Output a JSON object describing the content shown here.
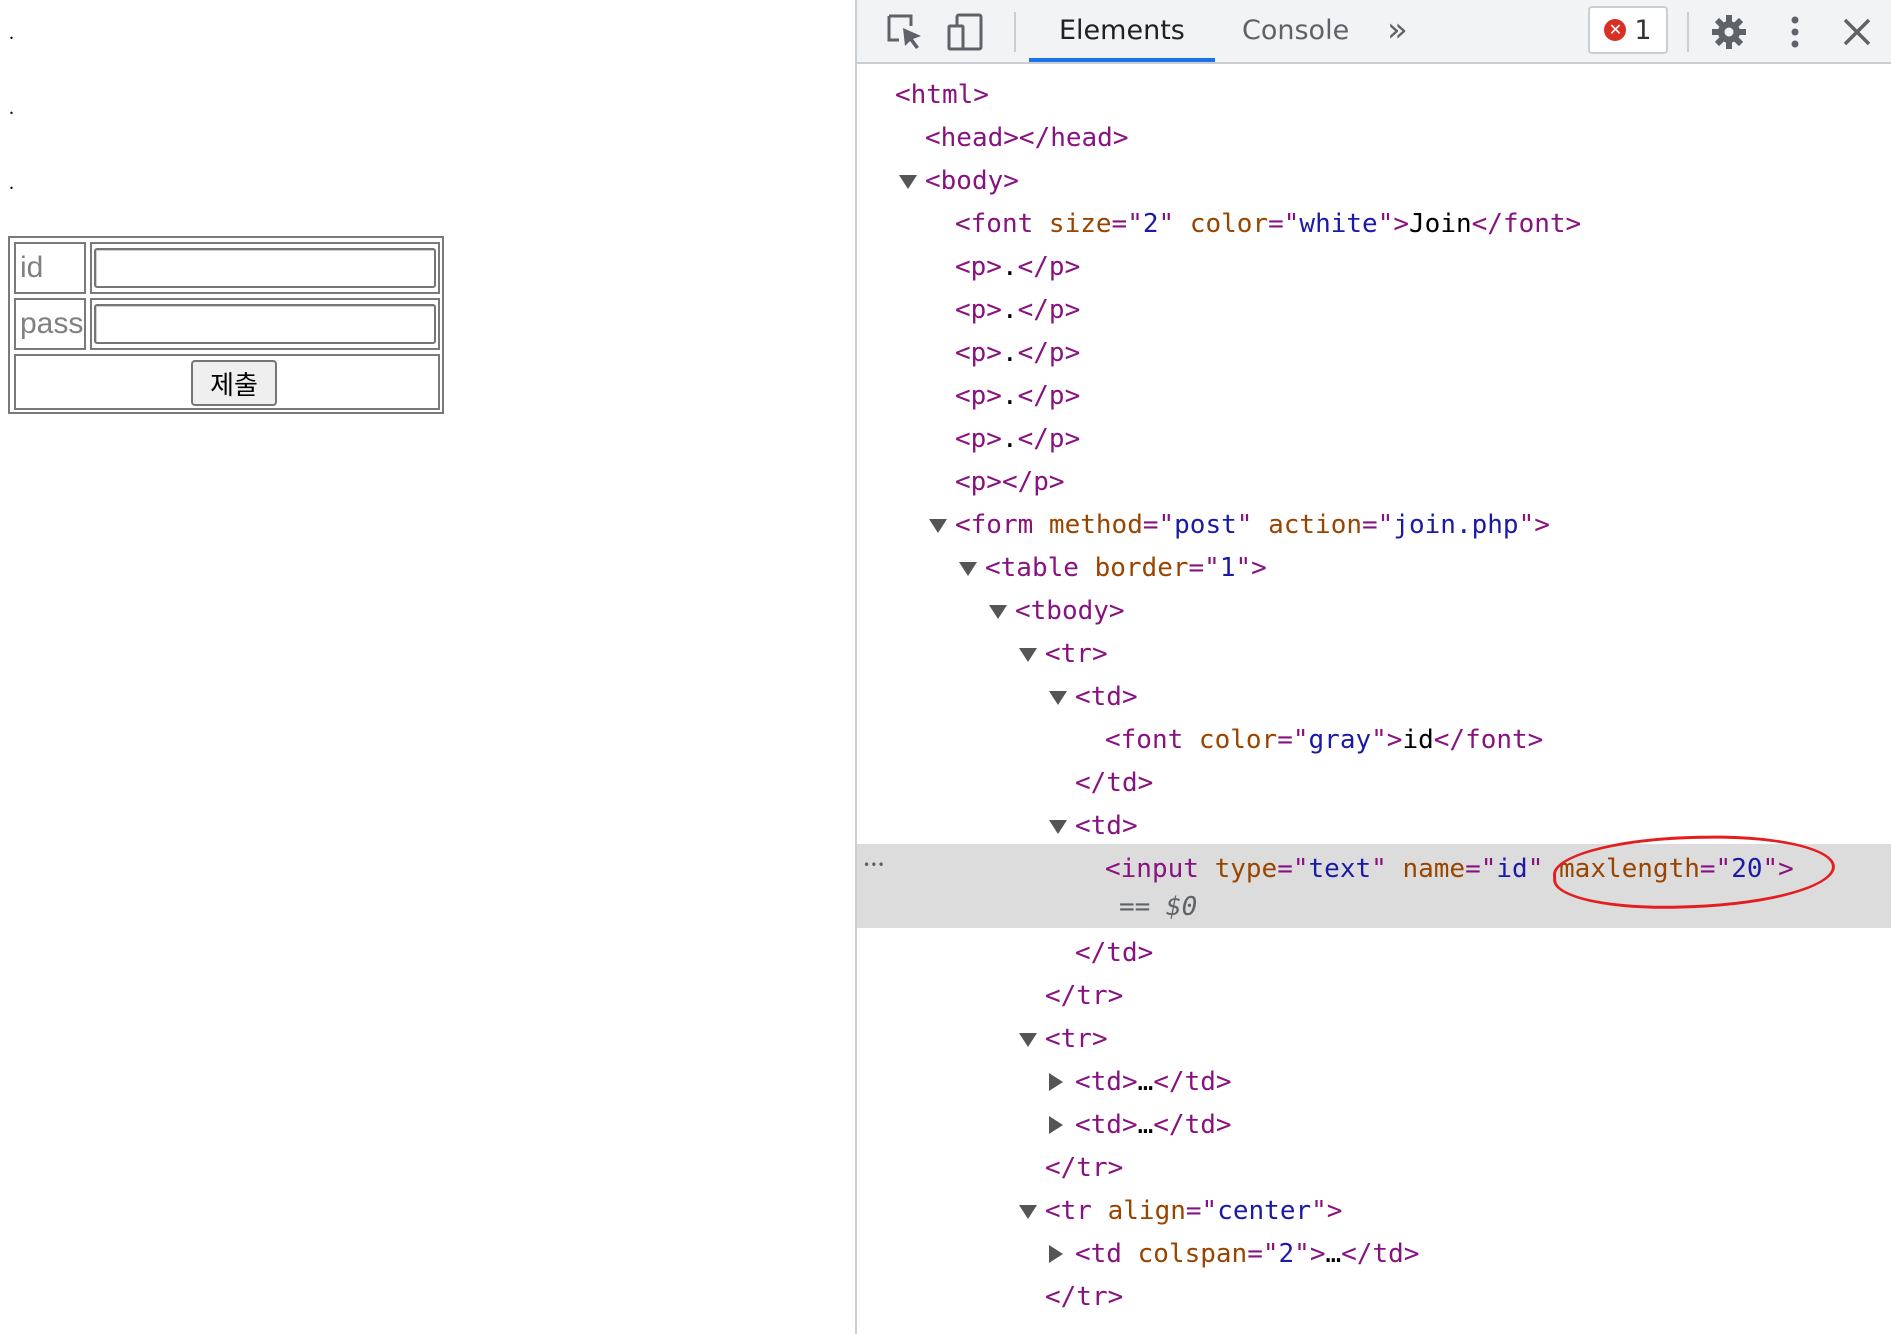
{
  "page": {
    "dots": [
      ".",
      ".",
      "."
    ],
    "form": {
      "id_label": "id",
      "pass_label": "pass",
      "submit_label": "제출"
    }
  },
  "devtools": {
    "tabs": [
      {
        "label": "Elements",
        "active": true
      },
      {
        "label": "Console",
        "active": false
      }
    ],
    "more_tabs": "»",
    "error_count": "1",
    "icons": [
      "inspect-element-icon",
      "device-toolbar-icon",
      "settings-icon",
      "more-options-icon",
      "close-icon"
    ],
    "dom_rows": [
      {
        "parts": [
          [
            "tag",
            "<html>"
          ]
        ]
      },
      {
        "parts": [
          [
            "tag",
            "<head></head>"
          ]
        ]
      },
      {
        "parts": [
          [
            "tag",
            "<body>"
          ]
        ]
      },
      {
        "parts": [
          [
            "tag",
            "<font "
          ],
          [
            "attr",
            "size"
          ],
          [
            "tag",
            "=\""
          ],
          [
            "val",
            "2"
          ],
          [
            "tag",
            "\" "
          ],
          [
            "attr",
            "color"
          ],
          [
            "tag",
            "=\""
          ],
          [
            "val",
            "white"
          ],
          [
            "tag",
            "\">"
          ],
          [
            "txt",
            "Join"
          ],
          [
            "tag",
            "</font>"
          ]
        ]
      },
      {
        "parts": [
          [
            "tag",
            "<p>"
          ],
          [
            "txt",
            "."
          ],
          [
            "tag",
            "</p>"
          ]
        ]
      },
      {
        "parts": [
          [
            "tag",
            "<p>"
          ],
          [
            "txt",
            "."
          ],
          [
            "tag",
            "</p>"
          ]
        ]
      },
      {
        "parts": [
          [
            "tag",
            "<p>"
          ],
          [
            "txt",
            "."
          ],
          [
            "tag",
            "</p>"
          ]
        ]
      },
      {
        "parts": [
          [
            "tag",
            "<p>"
          ],
          [
            "txt",
            "."
          ],
          [
            "tag",
            "</p>"
          ]
        ]
      },
      {
        "parts": [
          [
            "tag",
            "<p>"
          ],
          [
            "txt",
            "."
          ],
          [
            "tag",
            "</p>"
          ]
        ]
      },
      {
        "parts": [
          [
            "tag",
            "<p></p>"
          ]
        ]
      },
      {
        "parts": [
          [
            "tag",
            "<form "
          ],
          [
            "attr",
            "method"
          ],
          [
            "tag",
            "=\""
          ],
          [
            "val",
            "post"
          ],
          [
            "tag",
            "\" "
          ],
          [
            "attr",
            "action"
          ],
          [
            "tag",
            "=\""
          ],
          [
            "val",
            "join.php"
          ],
          [
            "tag",
            "\">"
          ]
        ]
      },
      {
        "parts": [
          [
            "tag",
            "<table "
          ],
          [
            "attr",
            "border"
          ],
          [
            "tag",
            "=\""
          ],
          [
            "val",
            "1"
          ],
          [
            "tag",
            "\">"
          ]
        ]
      },
      {
        "parts": [
          [
            "tag",
            "<tbody>"
          ]
        ]
      },
      {
        "parts": [
          [
            "tag",
            "<tr>"
          ]
        ]
      },
      {
        "parts": [
          [
            "tag",
            "<td>"
          ]
        ]
      },
      {
        "parts": [
          [
            "tag",
            "<font "
          ],
          [
            "attr",
            "color"
          ],
          [
            "tag",
            "=\""
          ],
          [
            "val",
            "gray"
          ],
          [
            "tag",
            "\">"
          ],
          [
            "txt",
            "id"
          ],
          [
            "tag",
            "</font>"
          ]
        ]
      },
      {
        "parts": [
          [
            "tag",
            "</td>"
          ]
        ]
      },
      {
        "parts": [
          [
            "tag",
            "<td>"
          ]
        ]
      },
      {
        "parts": [
          [
            "tag",
            "<input "
          ],
          [
            "attr",
            "type"
          ],
          [
            "tag",
            "=\""
          ],
          [
            "val",
            "text"
          ],
          [
            "tag",
            "\" "
          ],
          [
            "attr",
            "name"
          ],
          [
            "tag",
            "=\""
          ],
          [
            "val",
            "id"
          ],
          [
            "tag",
            "\" "
          ],
          [
            "attr",
            "maxlength"
          ],
          [
            "tag",
            "=\""
          ],
          [
            "val",
            "20"
          ],
          [
            "tag",
            "\">"
          ]
        ],
        "selected_suffix": "== $0"
      },
      {
        "parts": [
          [
            "tag",
            "</td>"
          ]
        ]
      },
      {
        "parts": [
          [
            "tag",
            "</tr>"
          ]
        ]
      },
      {
        "parts": [
          [
            "tag",
            "<tr>"
          ]
        ]
      },
      {
        "parts": [
          [
            "tag",
            "<td>"
          ],
          [
            "txt",
            "…"
          ],
          [
            "tag",
            "</td>"
          ]
        ]
      },
      {
        "parts": [
          [
            "tag",
            "<td>"
          ],
          [
            "txt",
            "…"
          ],
          [
            "tag",
            "</td>"
          ]
        ]
      },
      {
        "parts": [
          [
            "tag",
            "</tr>"
          ]
        ]
      },
      {
        "parts": [
          [
            "tag",
            "<tr "
          ],
          [
            "attr",
            "align"
          ],
          [
            "tag",
            "=\""
          ],
          [
            "val",
            "center"
          ],
          [
            "tag",
            "\">"
          ]
        ]
      },
      {
        "parts": [
          [
            "tag",
            "<td "
          ],
          [
            "attr",
            "colspan"
          ],
          [
            "tag",
            "=\""
          ],
          [
            "val",
            "2"
          ],
          [
            "tag",
            "\">"
          ],
          [
            "txt",
            "…"
          ],
          [
            "tag",
            "</td>"
          ]
        ]
      },
      {
        "parts": [
          [
            "tag",
            "</tr>"
          ]
        ]
      }
    ],
    "annotation_color": "#e41e1e"
  }
}
